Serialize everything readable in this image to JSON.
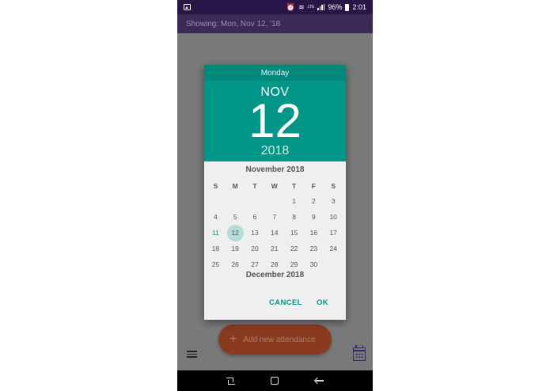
{
  "status_bar": {
    "battery": "96%",
    "time": "2:01",
    "network": "LTE",
    "icons": [
      "image-icon",
      "alarm-icon",
      "wifi-icon",
      "signal-icon",
      "battery-icon"
    ]
  },
  "app_bar": {
    "showing": "Showing: Mon, Nov 12, '18"
  },
  "fab": {
    "label": "Add new attendance",
    "icon": "plus-icon"
  },
  "bottom_bar": {
    "icons": [
      "menu-icon",
      "calendar-icon"
    ]
  },
  "nav_bar": {
    "icons": [
      "recent-apps-icon",
      "home-icon",
      "back-icon"
    ]
  },
  "dialog": {
    "weekday": "Monday",
    "month": "NOV",
    "day": "12",
    "year": "2018",
    "current_month": "November 2018",
    "next_month": "December 2018",
    "day_headers": [
      "S",
      "M",
      "T",
      "W",
      "T",
      "F",
      "S"
    ],
    "days": [
      "",
      "",
      "",
      "",
      "1",
      "2",
      "3",
      "4",
      "5",
      "6",
      "7",
      "8",
      "9",
      "10",
      "11",
      "12",
      "13",
      "14",
      "15",
      "16",
      "17",
      "18",
      "19",
      "20",
      "21",
      "22",
      "23",
      "24",
      "25",
      "26",
      "27",
      "28",
      "29",
      "30",
      ""
    ],
    "today": "11",
    "selected": "12",
    "cancel_label": "CANCEL",
    "ok_label": "OK"
  },
  "colors": {
    "accent": "#009688",
    "accent_dark": "#00897b",
    "status_bar": "#2a1548",
    "fab": "#8a3a1e"
  }
}
